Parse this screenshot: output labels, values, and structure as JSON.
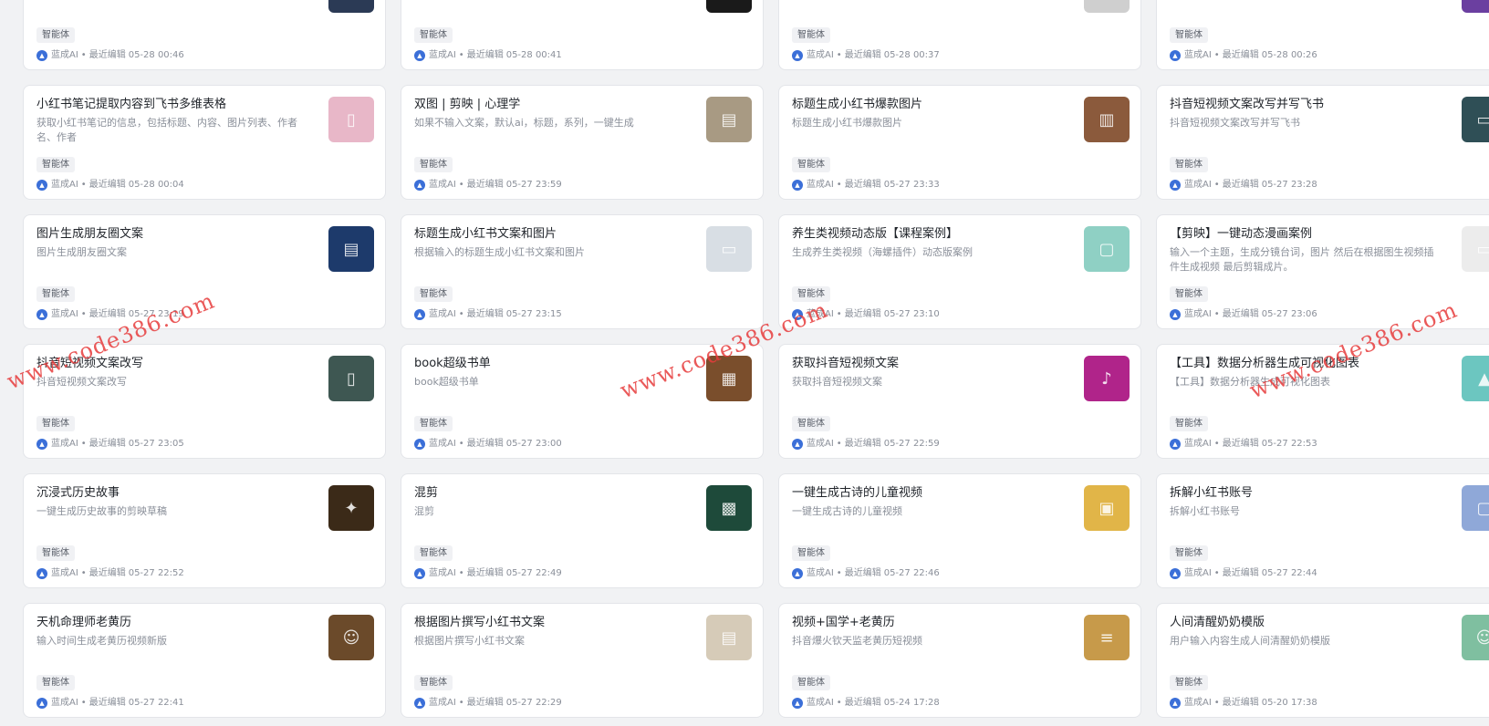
{
  "watermark_text": "www.code386.com",
  "badge_label": "智能体",
  "author": "蓝成AI",
  "edit_prefix": "最近编辑",
  "accent_color": "#3b6fd8",
  "cards": [
    {
      "title": "",
      "desc": "",
      "time": "05-28 00:46",
      "thumb_color": "#2b3a55",
      "thumb_icon": "dark-image"
    },
    {
      "title": "",
      "desc": "",
      "time": "05-28 00:41",
      "thumb_color": "#1a1a1a",
      "thumb_icon": "dark-image"
    },
    {
      "title": "",
      "desc": "",
      "time": "05-28 00:37",
      "thumb_color": "#cfcfcf",
      "thumb_icon": "gray-image"
    },
    {
      "title": "",
      "desc": "",
      "time": "05-28 00:26",
      "thumb_color": "#6b3fa0",
      "thumb_icon": "purple-image"
    },
    {
      "title": "小红书笔记提取内容到飞书多维表格",
      "desc": "获取小红书笔记的信息，包括标题、内容、图片列表、作者名、作者",
      "time": "05-28 00:04",
      "thumb_color": "#e8b7c8",
      "thumb_icon": "phone-image"
    },
    {
      "title": "双图 | 剪映 | 心理学",
      "desc": "如果不输入文案，默认ai，标题，系列，一键生成",
      "time": "05-27 23:59",
      "thumb_color": "#a89a83",
      "thumb_icon": "book-image"
    },
    {
      "title": "标题生成小红书爆款图片",
      "desc": "标题生成小红书爆款图片",
      "time": "05-27 23:33",
      "thumb_color": "#8b5a3c",
      "thumb_icon": "notebook-image"
    },
    {
      "title": "抖音短视频文案改写并写飞书",
      "desc": "抖音短视频文案改写并写飞书",
      "time": "05-27 23:28",
      "thumb_color": "#2f4f56",
      "thumb_icon": "screen-image"
    },
    {
      "title": "图片生成朋友圈文案",
      "desc": "图片生成朋友圈文案",
      "time": "05-27 23:19",
      "thumb_color": "#1d3a6b",
      "thumb_icon": "book-image"
    },
    {
      "title": "标题生成小红书文案和图片",
      "desc": "根据输入的标题生成小红书文案和图片",
      "time": "05-27 23:15",
      "thumb_color": "#d8dee4",
      "thumb_icon": "monitor-image"
    },
    {
      "title": "养生类视频动态版【课程案例】",
      "desc": "生成养生类视频（海螺插件）动态版案例",
      "time": "05-27 23:10",
      "thumb_color": "#8fd0c4",
      "thumb_icon": "window-image"
    },
    {
      "title": "【剪映】一键动态漫画案例",
      "desc": "输入一个主题，生成分镜台词，图片 然后在根据图生视频插件生成视频 最后剪辑成片。",
      "time": "05-27 23:06",
      "thumb_color": "#ececec",
      "thumb_icon": "monitor-image"
    },
    {
      "title": "抖音短视频文案改写",
      "desc": "抖音短视频文案改写",
      "time": "05-27 23:05",
      "thumb_color": "#3e5752",
      "thumb_icon": "phone-image"
    },
    {
      "title": "book超级书单",
      "desc": "book超级书单",
      "time": "05-27 23:00",
      "thumb_color": "#7a4e2c",
      "thumb_icon": "bookshelf-image"
    },
    {
      "title": "获取抖音短视频文案",
      "desc": "获取抖音短视频文案",
      "time": "05-27 22:59",
      "thumb_color": "#b0248a",
      "thumb_icon": "tiktok-image"
    },
    {
      "title": "【工具】数据分析器生成可视化图表",
      "desc": "【工具】数据分析器生成可视化图表",
      "time": "05-27 22:53",
      "thumb_color": "#6cc6c0",
      "thumb_icon": "chart-image"
    },
    {
      "title": "沉浸式历史故事",
      "desc": "一键生成历史故事的剪映草稿",
      "time": "05-27 22:52",
      "thumb_color": "#3b2a18",
      "thumb_icon": "lamp-image"
    },
    {
      "title": "混剪",
      "desc": "混剪",
      "time": "05-27 22:49",
      "thumb_color": "#1e4a3a",
      "thumb_icon": "pattern-image"
    },
    {
      "title": "一键生成古诗的儿童视频",
      "desc": "一键生成古诗的儿童视频",
      "time": "05-27 22:46",
      "thumb_color": "#e1b548",
      "thumb_icon": "class-image"
    },
    {
      "title": "拆解小红书账号",
      "desc": "拆解小红书账号",
      "time": "05-27 22:44",
      "thumb_color": "#8fa8d8",
      "thumb_icon": "window-image"
    },
    {
      "title": "天机命理师老黄历",
      "desc": "输入时间生成老黄历视频新版",
      "time": "05-27 22:41",
      "thumb_color": "#6b4a2a",
      "thumb_icon": "portrait-image"
    },
    {
      "title": "根据图片撰写小红书文案",
      "desc": "根据图片撰写小红书文案",
      "time": "05-27 22:29",
      "thumb_color": "#d6cbb8",
      "thumb_icon": "book-image"
    },
    {
      "title": "视频+国学+老黄历",
      "desc": "抖音爆火钦天监老黄历短视频",
      "time": "05-24 17:28",
      "thumb_color": "#c79a4a",
      "thumb_icon": "scroll-image"
    },
    {
      "title": "人间清醒奶奶模版",
      "desc": "用户输入内容生成人间清醒奶奶模版",
      "time": "05-20 17:38",
      "thumb_color": "#7fbfa0",
      "thumb_icon": "portrait-image"
    }
  ]
}
